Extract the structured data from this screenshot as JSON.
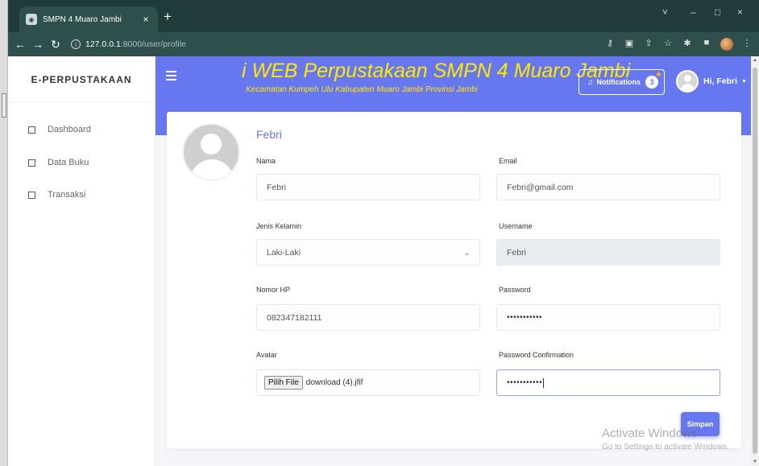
{
  "browser": {
    "tab_title": "SMPN 4 Muaro Jambi",
    "tab_close": "×",
    "new_tab": "+",
    "url_host": "127.0.0.1",
    "url_path": ":8000/user/profile",
    "window_controls": [
      "˅",
      "–",
      "□",
      "×"
    ]
  },
  "sidebar": {
    "brand": "E-PERPUSTAKAAN",
    "items": [
      {
        "label": "Dashboard"
      },
      {
        "label": "Data Buku"
      },
      {
        "label": "Transaksi"
      }
    ]
  },
  "header": {
    "title": "i WEB Perpustakaan SMPN 4 Muaro Jambi",
    "subtitle": "Kecamatan Kumpeh Ulu Kabupaten Muaro Jambi Provinsi Jambi",
    "notifications_label": "Notifications",
    "notifications_count": "3",
    "user_greeting": "Hi, Febri",
    "accent_color": "#6777ef",
    "title_color": "#ffe800"
  },
  "profile": {
    "name": "Febri",
    "fields": {
      "nama": {
        "label": "Nama",
        "value": "Febri"
      },
      "email": {
        "label": "Email",
        "value": "Febri@gmail.com"
      },
      "jenis_kelamin": {
        "label": "Jenis Kelamin",
        "value": "Laki-Laki"
      },
      "username": {
        "label": "Username",
        "value": "Febri"
      },
      "nomor_hp": {
        "label": "Nomor HP",
        "value": "082347182111"
      },
      "password": {
        "label": "Password",
        "value": "•••••••••••"
      },
      "avatar": {
        "label": "Avatar",
        "button": "Pilih File",
        "file": "download (4).jfif"
      },
      "password_confirmation": {
        "label": "Password Confirmation",
        "value": "•••••••••••"
      }
    },
    "save_label": "Simpan"
  },
  "watermark": {
    "line1": "Activate Windows",
    "line2": "Go to Settings to activate Windows."
  }
}
